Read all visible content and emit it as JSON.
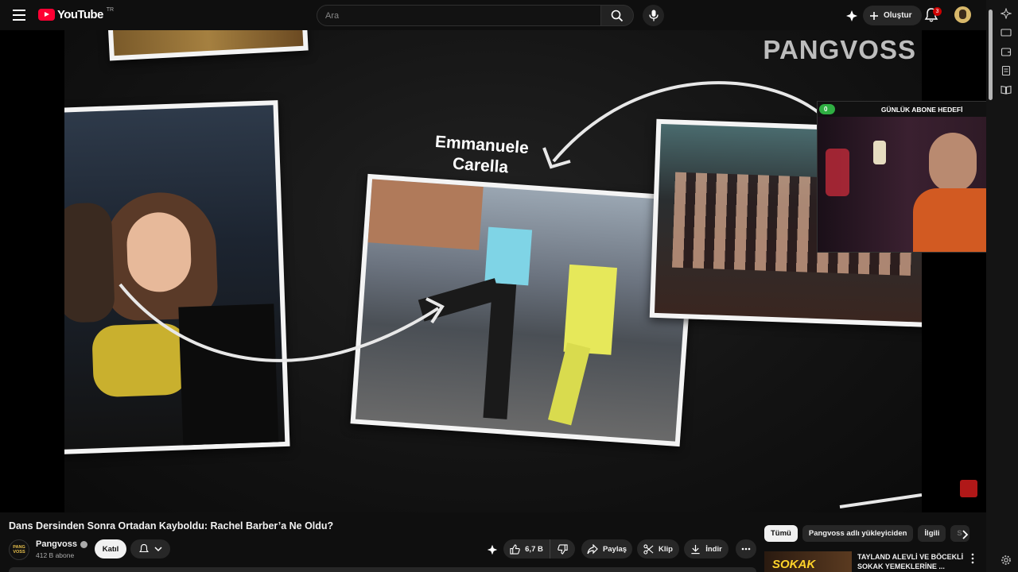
{
  "topbar": {
    "logo_text": "YouTube",
    "logo_region": "TR",
    "search_placeholder": "Ara",
    "create_label": "Oluştur",
    "notification_count": "3"
  },
  "video": {
    "brand_watermark": "PANGVOSS",
    "caption": "Emmanuele\nCarella",
    "title": "Dans Dersinden Sonra Ortadan Kayboldu: Rachel Barber’a Ne Oldu?"
  },
  "overlay": {
    "goal_label": "GÜNLÜK ABONE HEDEFİ",
    "goal_current": "0",
    "goal_target": "6"
  },
  "channel": {
    "name": "Pangvoss",
    "subscribers": "412 B abone",
    "avatar_text_1": "PANG",
    "avatar_text_2": "VOSS",
    "join_label": "Katıl"
  },
  "actions": {
    "likes": "6,7 B",
    "share": "Paylaş",
    "clip": "Klip",
    "download": "İndir"
  },
  "chips": [
    "Tümü",
    "Pangvoss adlı yükleyiciden",
    "İlgili",
    "S"
  ],
  "recommendation": {
    "thumb_text": "SOKAK",
    "title": "TAYLAND ALEVLİ VE BÖCEKLİ SOKAK YEMEKLERİNE ..."
  },
  "colors": {
    "brand_red": "#ff0033",
    "goal_green": "#2fae42",
    "background": "#0f0f0f"
  }
}
